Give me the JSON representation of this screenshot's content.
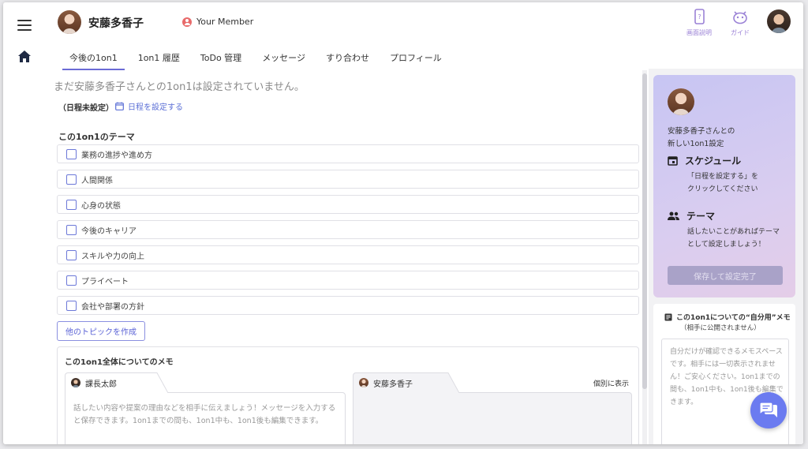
{
  "header": {
    "name": "安藤多香子",
    "member_label": "Your Member",
    "tools": [
      {
        "label": "画面説明",
        "icon": "phone-help-icon"
      },
      {
        "label": "ガイド",
        "icon": "guide-mascot-icon"
      }
    ]
  },
  "tabs": [
    {
      "label": "今後の1on1",
      "active": true
    },
    {
      "label": "1on1 履歴"
    },
    {
      "label": "ToDo 管理"
    },
    {
      "label": "メッセージ"
    },
    {
      "label": "すり合わせ"
    },
    {
      "label": "プロフィール"
    }
  ],
  "main": {
    "notice": "まだ安藤多香子さんとの1on1は設定されていません。",
    "unscheduled": "（日程未設定）",
    "set_schedule": "日程を設定する",
    "theme_title": "この1on1のテーマ",
    "topics": [
      "業務の進捗や進め方",
      "人間関係",
      "心身の状態",
      "今後のキャリア",
      "スキルや力の向上",
      "プライベート",
      "会社や部署の方針"
    ],
    "create_topic": "他のトピックを作成",
    "memo": {
      "title": "この1on1全体についてのメモ",
      "left_user": "課長太郎",
      "right_user": "安藤多香子",
      "individual": "個別に表示",
      "placeholder": "話したい内容や提案の理由などを相手に伝えましょう！メッセージを入力すると保存できます。1on1までの間も、1on1中も、1on1後も編集できます。"
    }
  },
  "guide": {
    "intro_line1": "安藤多香子さんとの",
    "intro_line2": "新しい1on1設定",
    "schedule_title": "スケジュール",
    "schedule_line1": "「日程を設定する」を",
    "schedule_line2": "クリックしてください",
    "theme_title": "テーマ",
    "theme_line1": "話したいことがあればテーマ",
    "theme_line2": "として設定しましょう！",
    "save_button": "保存して設定完了"
  },
  "private_memo": {
    "title": "この1on1についての“自分用”メモ",
    "subtitle": "（相手に公開されません）",
    "placeholder": "自分だけが確認できるメモスペースです。相手には一切表示されません！ご安心ください。1on1までの間も、1on1中も、1on1後も編集できます。"
  },
  "colors": {
    "accent": "#6b6bd6",
    "link": "#5b6fd6",
    "fab": "#6b7bf0",
    "guide_gradient_start": "#c7c5f3",
    "guide_gradient_end": "#e4cde8"
  }
}
